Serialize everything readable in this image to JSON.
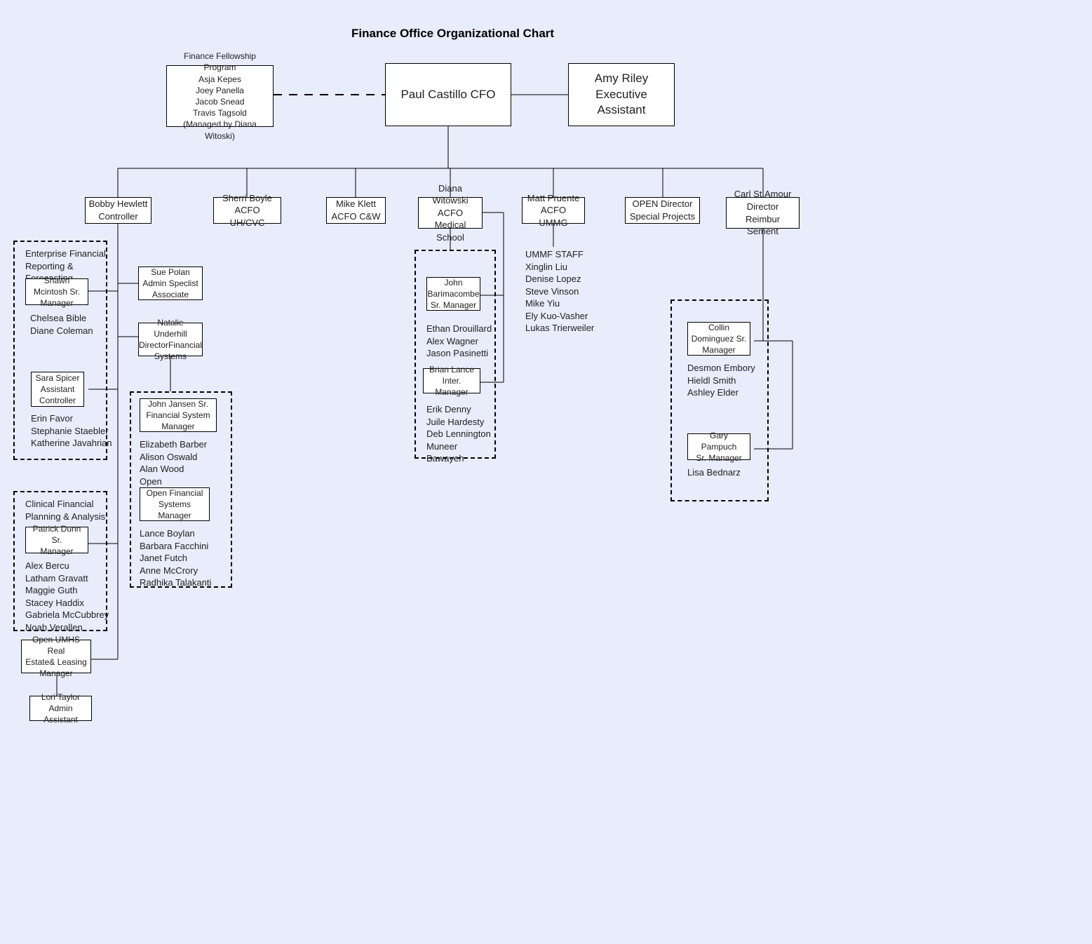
{
  "chart_data": {
    "type": "org-chart",
    "title": "Finance Office Organizational Chart",
    "root": "cfo",
    "nodes": {
      "cfo": {
        "name": "Paul Castillo",
        "title": "CFO",
        "children": [
          "controller",
          "acfo_uh",
          "acfo_cw",
          "acfo_med",
          "acfo_ummg",
          "open_director_sp",
          "director_reimb"
        ],
        "side": [
          "fellowship",
          "exec_asst"
        ]
      },
      "fellowship": {
        "title": "Finance Fellowship Program",
        "members": [
          "Asja Kepes",
          "Joey Panella",
          "Jacob Snead",
          "Travis Tagsold"
        ],
        "note": "(Managed by Diana Witoski)"
      },
      "exec_asst": {
        "name": "Amy Riley",
        "title": "Executive Assistant"
      },
      "controller": {
        "name": "Bobby Hewlett",
        "title": "Controller",
        "children": [
          "admin_spec",
          "dir_fin_sys",
          "asst_controller",
          "efrf_mgr",
          "cfpa_mgr",
          "re_leasing_mgr"
        ]
      },
      "acfo_uh": {
        "name": "Sherri Boyle",
        "title": "ACFO UH/CVC"
      },
      "acfo_cw": {
        "name": "Mike Klett",
        "title": "ACFO C&W"
      },
      "acfo_med": {
        "name": "Diana Witowski",
        "title": "ACFO Medical School",
        "children": [
          "med_sr_mgr",
          "med_int_mgr"
        ]
      },
      "acfo_ummg": {
        "name": "Matt Pruente",
        "title": "ACFO UMMG",
        "children": [
          "ummf_staff"
        ]
      },
      "open_director_sp": {
        "name": "OPEN Director",
        "title": "Special Projects"
      },
      "director_reimb": {
        "name": "Carl St.Amour",
        "title": "Director Reimbur Sement",
        "children": [
          "cd_sr_mgr",
          "gp_sr_mgr"
        ]
      },
      "admin_spec": {
        "name": "Sue Polan",
        "title": "Admin Speclist Associate"
      },
      "dir_fin_sys": {
        "name": "Natalie Underhill",
        "title": "DirectorFinancial Systems",
        "children": [
          "sr_fs_mgr",
          "open_fs_mgr"
        ]
      },
      "asst_controller": {
        "name": "Sara Spicer",
        "title": "Assistant Controller",
        "members": [
          "Erin Favor",
          "Stephanie Staebler",
          "Katherine Javahrian"
        ]
      },
      "efrf_mgr": {
        "group": "Enterprise Financial Reporting & Forecasting",
        "name": "Shawn Mcintosh",
        "title": "Sr. Manager",
        "members": [
          "Chelsea Bible",
          "Diane Coleman"
        ]
      },
      "sr_fs_mgr": {
        "name": "John Jansen",
        "title": "Sr. Financial System Manager",
        "members": [
          "Elizabeth Barber",
          "Alison Oswald",
          "Alan Wood",
          "Open"
        ]
      },
      "open_fs_mgr": {
        "name": "Open",
        "title": "Financial Systems Manager",
        "members": [
          "Lance Boylan",
          "Barbara Facchini",
          "Janet Futch",
          "Anne McCrory",
          "Radhika Talakanti"
        ]
      },
      "cfpa_mgr": {
        "group": "Clinical Financial Planning & Analysis",
        "name": "Patrick Dunn",
        "title": "Sr. Manager",
        "members": [
          "Alex Bercu",
          "Latham Gravatt",
          "Maggie Guth",
          "Stacey Haddix",
          "Gabriela McCubbrey",
          "Noah Verallen"
        ]
      },
      "re_leasing_mgr": {
        "name": "Open",
        "title": "UMHS Real Estate& Leasing Manager",
        "children": [
          "admin_asst"
        ]
      },
      "admin_asst": {
        "name": "Lori Taylor",
        "title": "Admin Assistant"
      },
      "med_sr_mgr": {
        "name": "John Barimacombe",
        "title": "Sr. Manager",
        "members": [
          "Ethan Drouillard",
          "Alex Wagner",
          "Jason Pasinetti"
        ]
      },
      "med_int_mgr": {
        "name": "Brian Lance",
        "title": "Inter. Manager",
        "members": [
          "Erik Denny",
          "Juile Hardesty",
          "Deb Lennington",
          "Muneer",
          "Bawayeh"
        ]
      },
      "ummf_staff": {
        "title": "UMMF STAFF",
        "members": [
          "Xinglin Liu",
          "Denise Lopez",
          "Steve Vinson",
          "Mike Yiu",
          "Ely Kuo-Vasher",
          "Lukas Trierweiler"
        ]
      },
      "cd_sr_mgr": {
        "name": "Collin Dominguez",
        "title": "Sr. Manager",
        "members": [
          "Desmon Embory",
          "Hieldl Smith",
          "Ashley Elder"
        ]
      },
      "gp_sr_mgr": {
        "name": "Gary Pampuch",
        "title": "Sr. Manager",
        "members": [
          "Lisa Bednarz"
        ]
      }
    }
  },
  "title": "Finance Office Organizational Chart",
  "top": {
    "fellowship": {
      "l1": "Finance Fellowship Program",
      "l2": "Asja Kepes",
      "l3": "Joey Panella",
      "l4": "Jacob Snead",
      "l5": "Travis Tagsold",
      "l6": "(Managed by Diana Witoski)"
    },
    "cfo": {
      "l1": "Paul Castillo CFO"
    },
    "ea": {
      "l1": "Amy Riley",
      "l2": "Executive Assistant"
    }
  },
  "row": {
    "controller": {
      "l1": "Bobby Hewlett",
      "l2": "Controller"
    },
    "sherri": {
      "l1": "Sherri Boyle",
      "l2": "ACFO UH/CVC"
    },
    "mike": {
      "l1": "Mike Klett",
      "l2": "ACFO C&W"
    },
    "diana": {
      "l1": "Diana Witowski",
      "l2": "ACFO Medical",
      "l3": "School"
    },
    "matt": {
      "l1": "Matt Pruente",
      "l2": "ACFO UMMG"
    },
    "open": {
      "l1": "OPEN Director",
      "l2": "Special Projects"
    },
    "carl": {
      "l1": "Carl St.Amour",
      "l2": "Director",
      "l3": "Reimbur Sement"
    }
  },
  "efrf": {
    "title": "Enterprise Financial\nReporting &\nForecasting",
    "mgr": {
      "l1": "Shawn Mcintosh Sr.",
      "l2": "Manager"
    },
    "staff": {
      "l1": "Chelsea Bible",
      "l2": "Diane Coleman"
    }
  },
  "sue": {
    "l1": "Sue Polan",
    "l2": "Admin Speclist",
    "l3": "Associate"
  },
  "natalie": {
    "l1": "Natalie Underhill",
    "l2": "DirectorFinancial",
    "l3": "Systems"
  },
  "sara": {
    "box": {
      "l1": "Sara Spicer",
      "l2": "Assistant",
      "l3": "Controller"
    },
    "staff": {
      "l1": "Erin Favor",
      "l2": "Stephanie Staebler",
      "l3": "Katherine Javahrian"
    }
  },
  "fsgrp": {
    "jj": {
      "l1": "John Jansen Sr.",
      "l2": "Financial System",
      "l3": "Manager"
    },
    "jjstaff": {
      "l1": "Elizabeth Barber",
      "l2": "Alison Oswald",
      "l3": "Alan Wood",
      "l4": "Open"
    },
    "open": {
      "l1": "Open Financial",
      "l2": "Systems",
      "l3": "Manager"
    },
    "openstaff": {
      "l1": "Lance Boylan",
      "l2": "Barbara Facchini",
      "l3": "Janet Futch",
      "l4": "Anne McCrory",
      "l5": "Radhika Talakanti"
    }
  },
  "cfpa": {
    "title": "Clinical Financial\nPlanning & Analysis",
    "mgr": {
      "l1": "Patrick Dunn Sr.",
      "l2": "Manager"
    },
    "staff": {
      "l1": "Alex Bercu",
      "l2": "Latham Gravatt",
      "l3": "Maggie Guth",
      "l4": "Stacey Haddix",
      "l5": "Gabriela McCubbrey",
      "l6": "Noah Verallen"
    }
  },
  "re": {
    "l1": "Open UMHS Real",
    "l2": "Estate& Leasing",
    "l3": "Manager"
  },
  "lori": {
    "l1": "Lori Taylor",
    "l2": "Admin Assistant"
  },
  "medgrp": {
    "jb": {
      "l1": "John",
      "l2": "Barimacombe",
      "l3": "Sr. Manager"
    },
    "jbstaff": {
      "l1": "Ethan Drouillard",
      "l2": "Alex Wagner",
      "l3": "Jason Pasinetti"
    },
    "bl": {
      "l1": "Brian Lance",
      "l2": "Inter. Manager"
    },
    "blstaff": {
      "l1": "Erik Denny",
      "l2": "Juile Hardesty",
      "l3": "Deb Lennington",
      "l4": "Muneer",
      "l5": "Bawayeh"
    }
  },
  "ummf": {
    "l1": "UMMF STAFF",
    "l2": "Xinglin Liu",
    "l3": "Denise Lopez",
    "l4": "Steve Vinson",
    "l5": "Mike Yiu",
    "l6": "Ely Kuo-Vasher",
    "l7": "Lukas Trierweiler"
  },
  "right": {
    "cd": {
      "l1": "Collin",
      "l2": "Dominguez Sr.",
      "l3": "Manager"
    },
    "cdstaff": {
      "l1": "Desmon Embory",
      "l2": "Hieldl Smith",
      "l3": "Ashley Elder"
    },
    "gp": {
      "l1": "Gary Pampuch",
      "l2": "Sr. Manager"
    },
    "gpstaff": {
      "l1": "Lisa Bednarz"
    }
  }
}
